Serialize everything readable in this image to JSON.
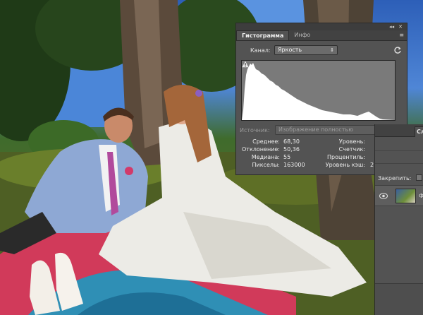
{
  "photo": {
    "description_icon": "photo-background"
  },
  "histogram_panel": {
    "tabs": [
      {
        "label": "Гистограмма",
        "active": true
      },
      {
        "label": "Инфо",
        "active": false
      }
    ],
    "topbar_controls": [
      "◂◂",
      "✕"
    ],
    "menu_icon": "≡",
    "channel_label": "Канал:",
    "channel_value": "Яркость",
    "source_label": "Источник:",
    "source_value": "Изображение полностью",
    "stats_left": [
      {
        "key": "Среднее:",
        "value": "68,30"
      },
      {
        "key": "Отклонение:",
        "value": "50,36"
      },
      {
        "key": "Медиана:",
        "value": "55"
      },
      {
        "key": "Пикселы:",
        "value": "163000"
      }
    ],
    "stats_right": [
      {
        "key": "Уровень:",
        "value": ""
      },
      {
        "key": "Счетчик:",
        "value": ""
      },
      {
        "key": "Процентиль:",
        "value": ""
      },
      {
        "key": "Уровень кэш:",
        "value": "2"
      }
    ],
    "histogram_color": "#ffffff",
    "histogram_bg": "#7a7a7a"
  },
  "side_panel": {
    "tab_label": "Сл",
    "lock_label": "Закрепить:",
    "layer_name": "Ф"
  }
}
